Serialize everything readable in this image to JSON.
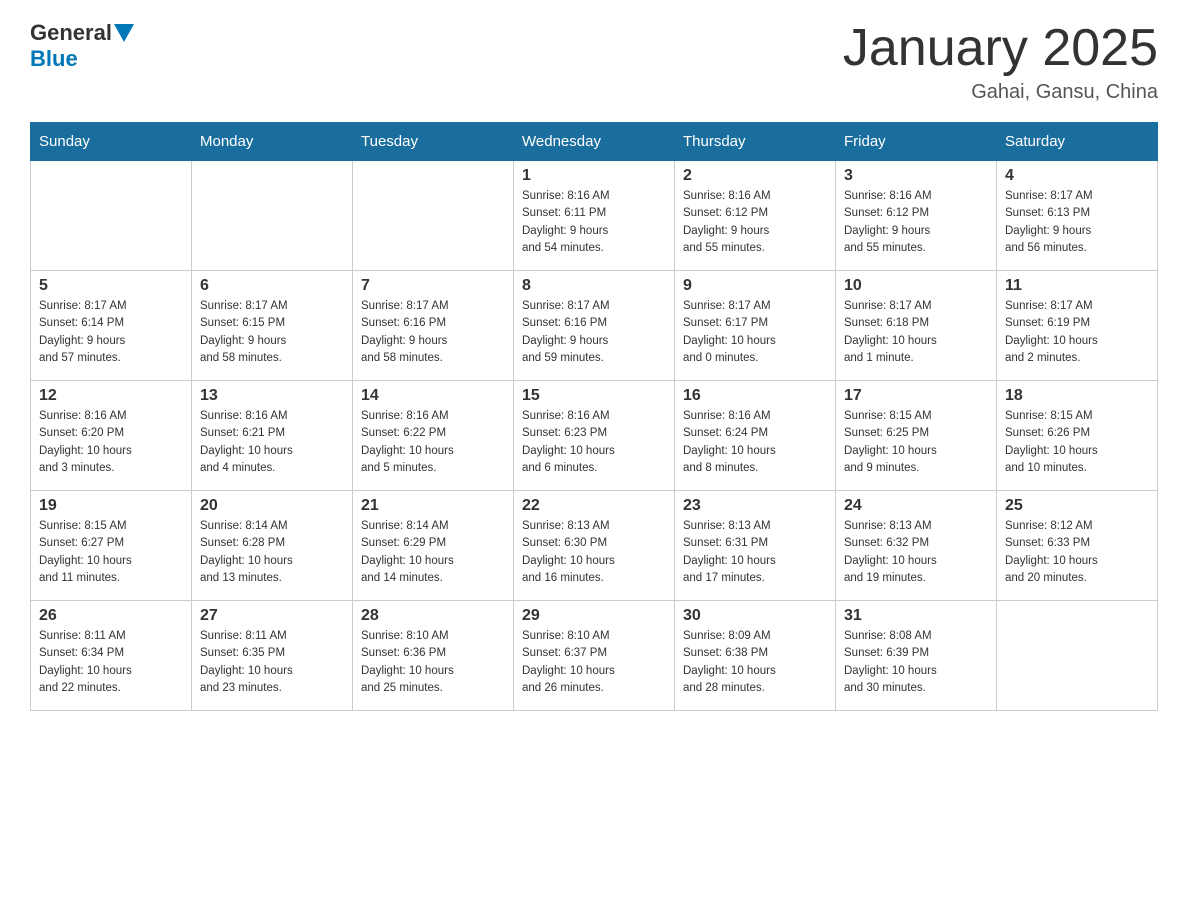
{
  "header": {
    "logo_general": "General",
    "logo_blue": "Blue",
    "month_title": "January 2025",
    "location": "Gahai, Gansu, China"
  },
  "weekdays": [
    "Sunday",
    "Monday",
    "Tuesday",
    "Wednesday",
    "Thursday",
    "Friday",
    "Saturday"
  ],
  "weeks": [
    [
      {
        "day": "",
        "info": ""
      },
      {
        "day": "",
        "info": ""
      },
      {
        "day": "",
        "info": ""
      },
      {
        "day": "1",
        "info": "Sunrise: 8:16 AM\nSunset: 6:11 PM\nDaylight: 9 hours\nand 54 minutes."
      },
      {
        "day": "2",
        "info": "Sunrise: 8:16 AM\nSunset: 6:12 PM\nDaylight: 9 hours\nand 55 minutes."
      },
      {
        "day": "3",
        "info": "Sunrise: 8:16 AM\nSunset: 6:12 PM\nDaylight: 9 hours\nand 55 minutes."
      },
      {
        "day": "4",
        "info": "Sunrise: 8:17 AM\nSunset: 6:13 PM\nDaylight: 9 hours\nand 56 minutes."
      }
    ],
    [
      {
        "day": "5",
        "info": "Sunrise: 8:17 AM\nSunset: 6:14 PM\nDaylight: 9 hours\nand 57 minutes."
      },
      {
        "day": "6",
        "info": "Sunrise: 8:17 AM\nSunset: 6:15 PM\nDaylight: 9 hours\nand 58 minutes."
      },
      {
        "day": "7",
        "info": "Sunrise: 8:17 AM\nSunset: 6:16 PM\nDaylight: 9 hours\nand 58 minutes."
      },
      {
        "day": "8",
        "info": "Sunrise: 8:17 AM\nSunset: 6:16 PM\nDaylight: 9 hours\nand 59 minutes."
      },
      {
        "day": "9",
        "info": "Sunrise: 8:17 AM\nSunset: 6:17 PM\nDaylight: 10 hours\nand 0 minutes."
      },
      {
        "day": "10",
        "info": "Sunrise: 8:17 AM\nSunset: 6:18 PM\nDaylight: 10 hours\nand 1 minute."
      },
      {
        "day": "11",
        "info": "Sunrise: 8:17 AM\nSunset: 6:19 PM\nDaylight: 10 hours\nand 2 minutes."
      }
    ],
    [
      {
        "day": "12",
        "info": "Sunrise: 8:16 AM\nSunset: 6:20 PM\nDaylight: 10 hours\nand 3 minutes."
      },
      {
        "day": "13",
        "info": "Sunrise: 8:16 AM\nSunset: 6:21 PM\nDaylight: 10 hours\nand 4 minutes."
      },
      {
        "day": "14",
        "info": "Sunrise: 8:16 AM\nSunset: 6:22 PM\nDaylight: 10 hours\nand 5 minutes."
      },
      {
        "day": "15",
        "info": "Sunrise: 8:16 AM\nSunset: 6:23 PM\nDaylight: 10 hours\nand 6 minutes."
      },
      {
        "day": "16",
        "info": "Sunrise: 8:16 AM\nSunset: 6:24 PM\nDaylight: 10 hours\nand 8 minutes."
      },
      {
        "day": "17",
        "info": "Sunrise: 8:15 AM\nSunset: 6:25 PM\nDaylight: 10 hours\nand 9 minutes."
      },
      {
        "day": "18",
        "info": "Sunrise: 8:15 AM\nSunset: 6:26 PM\nDaylight: 10 hours\nand 10 minutes."
      }
    ],
    [
      {
        "day": "19",
        "info": "Sunrise: 8:15 AM\nSunset: 6:27 PM\nDaylight: 10 hours\nand 11 minutes."
      },
      {
        "day": "20",
        "info": "Sunrise: 8:14 AM\nSunset: 6:28 PM\nDaylight: 10 hours\nand 13 minutes."
      },
      {
        "day": "21",
        "info": "Sunrise: 8:14 AM\nSunset: 6:29 PM\nDaylight: 10 hours\nand 14 minutes."
      },
      {
        "day": "22",
        "info": "Sunrise: 8:13 AM\nSunset: 6:30 PM\nDaylight: 10 hours\nand 16 minutes."
      },
      {
        "day": "23",
        "info": "Sunrise: 8:13 AM\nSunset: 6:31 PM\nDaylight: 10 hours\nand 17 minutes."
      },
      {
        "day": "24",
        "info": "Sunrise: 8:13 AM\nSunset: 6:32 PM\nDaylight: 10 hours\nand 19 minutes."
      },
      {
        "day": "25",
        "info": "Sunrise: 8:12 AM\nSunset: 6:33 PM\nDaylight: 10 hours\nand 20 minutes."
      }
    ],
    [
      {
        "day": "26",
        "info": "Sunrise: 8:11 AM\nSunset: 6:34 PM\nDaylight: 10 hours\nand 22 minutes."
      },
      {
        "day": "27",
        "info": "Sunrise: 8:11 AM\nSunset: 6:35 PM\nDaylight: 10 hours\nand 23 minutes."
      },
      {
        "day": "28",
        "info": "Sunrise: 8:10 AM\nSunset: 6:36 PM\nDaylight: 10 hours\nand 25 minutes."
      },
      {
        "day": "29",
        "info": "Sunrise: 8:10 AM\nSunset: 6:37 PM\nDaylight: 10 hours\nand 26 minutes."
      },
      {
        "day": "30",
        "info": "Sunrise: 8:09 AM\nSunset: 6:38 PM\nDaylight: 10 hours\nand 28 minutes."
      },
      {
        "day": "31",
        "info": "Sunrise: 8:08 AM\nSunset: 6:39 PM\nDaylight: 10 hours\nand 30 minutes."
      },
      {
        "day": "",
        "info": ""
      }
    ]
  ]
}
